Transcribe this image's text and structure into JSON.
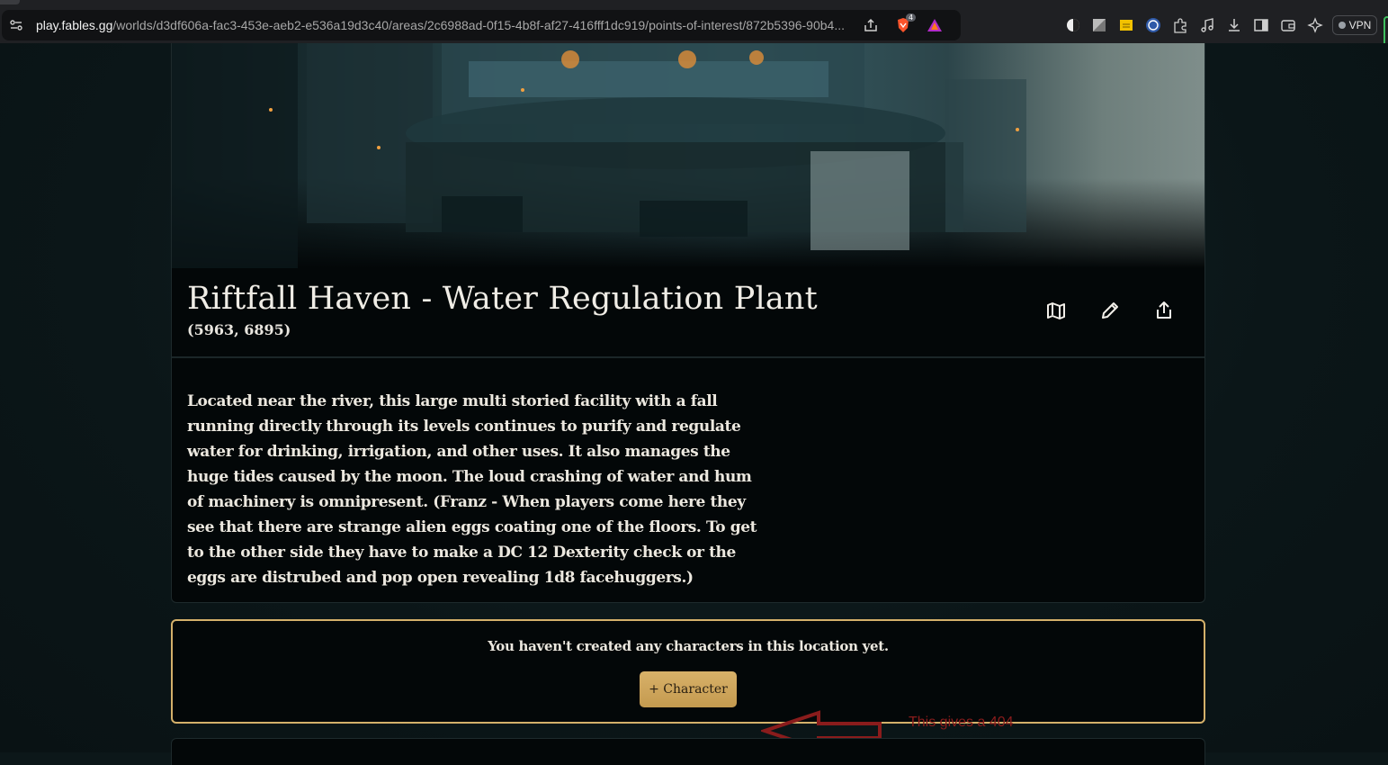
{
  "browser": {
    "url_host": "play.fables.gg",
    "url_path": "/worlds/d3df606a-fac3-453e-aeb2-e536a19d3c40/areas/2c6988ad-0f15-4b8f-af27-416fff1dc919/points-of-interest/872b5396-90b4...",
    "brave_badge_count": "4",
    "vpn_label": "VPN",
    "toolbar_icons": [
      "contrast-icon",
      "image-icon",
      "note-icon",
      "translate-icon",
      "extensions-icon",
      "music-icon",
      "download-icon",
      "sidebar-icon",
      "wallet-icon",
      "leo-ai-icon"
    ]
  },
  "location": {
    "title": "Riftfall Haven - Water Regulation Plant",
    "coords": "(5963, 6895)",
    "description": "Located near the river, this large multi storied facility with a fall running directly through its levels continues to purify and regulate water for drinking, irrigation, and other uses. It also manages the huge tides caused by the moon. The loud crashing of water and hum of machinery is omnipresent. (Franz - When players come here they see that there are strange alien eggs coating one of the floors. To get to the other side they have to make a DC 12 Dexterity check or the eggs are distrubed and pop open revealing 1d8 facehuggers.)",
    "actions": [
      "map-icon",
      "edit-icon",
      "share-icon"
    ]
  },
  "characters": {
    "empty_message": "You haven't created any characters in this location yet.",
    "add_button_label": "+ Character"
  },
  "annotation": {
    "text": "This gives a 404 error.",
    "color": "#8a1c1c"
  },
  "colors": {
    "accent_gold": "#d4b06a",
    "button_gold": "#c9a157",
    "page_bg": "#0b1618",
    "card_bg": "#030708"
  }
}
